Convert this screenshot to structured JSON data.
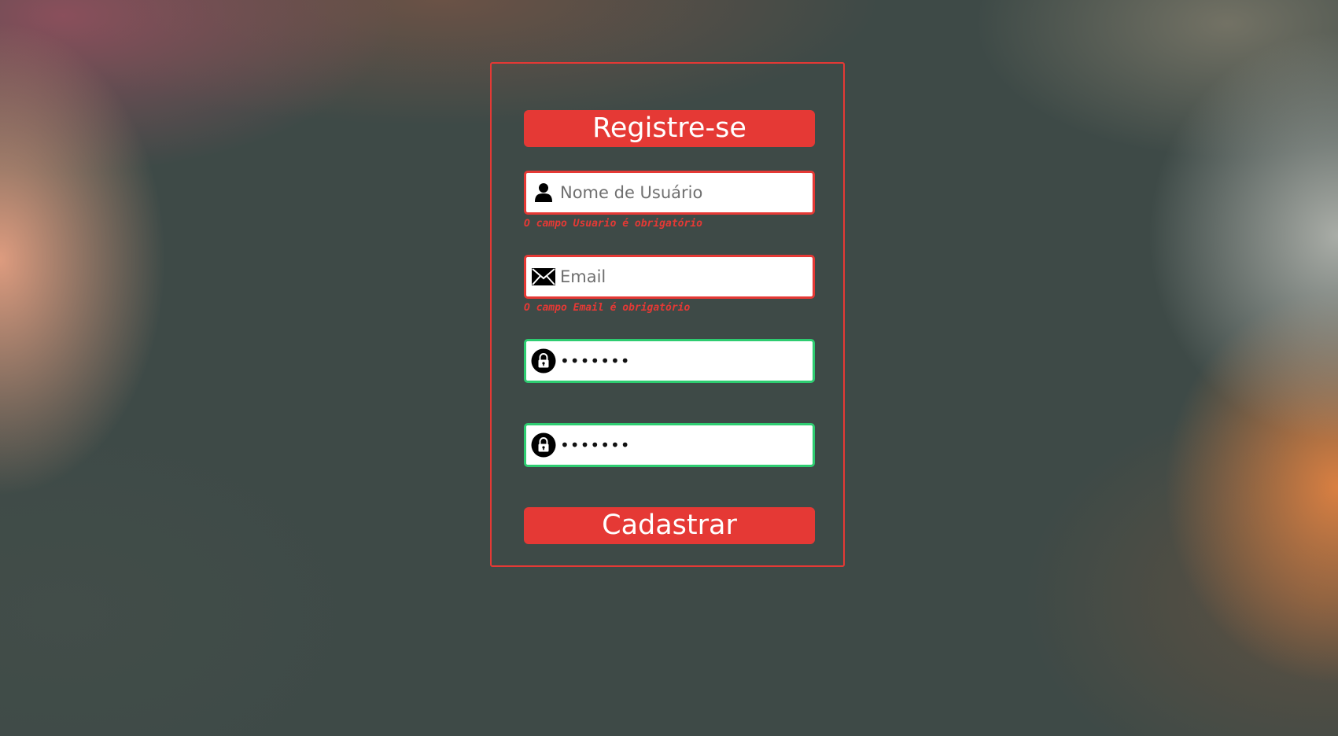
{
  "form": {
    "title": "Registre-se",
    "username": {
      "icon": "user-icon",
      "placeholder": "Nome de Usuário",
      "value": "",
      "error": "O campo Usuario é obrigatório",
      "status_color": "#e53935"
    },
    "email": {
      "icon": "envelope-icon",
      "placeholder": "Email",
      "value": "",
      "error": "O campo Email é obrigatório",
      "status_color": "#e53935"
    },
    "password": {
      "icon": "lock-icon",
      "value": "1234567",
      "status_color": "#2ecc71"
    },
    "password_confirm": {
      "icon": "lock-icon",
      "value": "1234567",
      "status_color": "#2ecc71"
    },
    "submit_label": "Cadastrar"
  },
  "colors": {
    "accent": "#e53935",
    "valid": "#2ecc71",
    "background": "#3e4a47"
  }
}
